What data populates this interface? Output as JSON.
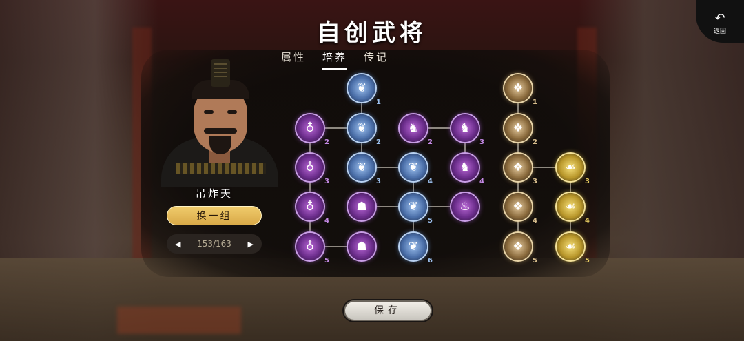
{
  "header": {
    "title": "自创武将"
  },
  "back": {
    "icon": "return-arrow-icon",
    "label": "返回"
  },
  "tabs": [
    {
      "label": "属性",
      "active": false
    },
    {
      "label": "培养",
      "active": true
    },
    {
      "label": "传记",
      "active": false
    }
  ],
  "hero": {
    "name": "吊炸天"
  },
  "actions": {
    "swap_label": "换一组",
    "save_label": "保存"
  },
  "pager": {
    "current": "153/163",
    "prev_icon": "triangle-left-icon",
    "next_icon": "triangle-right-icon"
  },
  "colors": {
    "purple": "#a35ed0",
    "blue": "#6a9adc",
    "gold": "#c9a86a",
    "yellow": "#e6c84a",
    "swap_button": "#e2b558"
  },
  "skill_tree": {
    "nodes": [
      {
        "id": "p1",
        "color": "purple",
        "icon": "bag-icon",
        "level": "2"
      },
      {
        "id": "p2",
        "color": "purple",
        "icon": "bag-icon",
        "level": "3"
      },
      {
        "id": "p3",
        "color": "purple",
        "icon": "bag-icon",
        "level": "4"
      },
      {
        "id": "p4",
        "color": "purple",
        "icon": "bag-icon",
        "level": "5"
      },
      {
        "id": "p5",
        "color": "purple",
        "icon": "helmet-icon",
        "level": ""
      },
      {
        "id": "p6",
        "color": "purple",
        "icon": "helmet-icon",
        "level": ""
      },
      {
        "id": "b1",
        "color": "blue",
        "icon": "feather-icon",
        "level": "1"
      },
      {
        "id": "b2",
        "color": "blue",
        "icon": "feather-icon",
        "level": "2"
      },
      {
        "id": "b3",
        "color": "blue",
        "icon": "feather-icon",
        "level": "3"
      },
      {
        "id": "b4",
        "color": "blue",
        "icon": "feather-icon",
        "level": "4"
      },
      {
        "id": "b5",
        "color": "blue",
        "icon": "feather-icon",
        "level": "5"
      },
      {
        "id": "b6",
        "color": "blue",
        "icon": "feather-icon",
        "level": "6"
      },
      {
        "id": "m1",
        "color": "purple",
        "icon": "figure-icon",
        "level": "2"
      },
      {
        "id": "m2",
        "color": "purple",
        "icon": "figure-icon",
        "level": "3"
      },
      {
        "id": "m3",
        "color": "purple",
        "icon": "figure-icon",
        "level": "4"
      },
      {
        "id": "m4",
        "color": "purple",
        "icon": "flame-icon",
        "level": ""
      },
      {
        "id": "g1",
        "color": "gold",
        "icon": "scroll-icon",
        "level": "1"
      },
      {
        "id": "g2",
        "color": "gold",
        "icon": "scroll-icon",
        "level": "2"
      },
      {
        "id": "g3",
        "color": "gold",
        "icon": "scroll-icon",
        "level": "3"
      },
      {
        "id": "g4",
        "color": "gold",
        "icon": "scroll-icon",
        "level": "4"
      },
      {
        "id": "g5",
        "color": "gold",
        "icon": "scroll-icon",
        "level": "5"
      },
      {
        "id": "y1",
        "color": "yellow",
        "icon": "hands-icon",
        "level": "3"
      },
      {
        "id": "y2",
        "color": "yellow",
        "icon": "hands-icon",
        "level": "4"
      },
      {
        "id": "y3",
        "color": "yellow",
        "icon": "hands-icon",
        "level": "5"
      }
    ]
  }
}
